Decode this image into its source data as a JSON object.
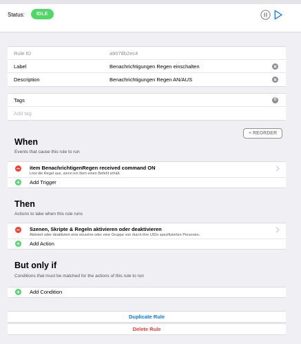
{
  "status": {
    "label": "Status:",
    "value": "IDLE",
    "color": "#4cd964"
  },
  "controls": {
    "pause_icon": "pause-circle-icon",
    "play_icon": "play-icon",
    "accent": "#007aff"
  },
  "fields": {
    "rule_id": {
      "label": "Rule ID",
      "value": "a9078b2ec4"
    },
    "label": {
      "label": "Label",
      "value": "Benachrichtigungen Regen einschalten"
    },
    "description": {
      "label": "Description",
      "value": "Benachrichtigungen Regen AN/AUS"
    }
  },
  "tags": {
    "label": "Tags",
    "count": "0",
    "placeholder": "Add tag"
  },
  "reorder_label": "≡ REORDER",
  "when": {
    "title": "When",
    "subtitle": "Events that cause this rule to run",
    "items": [
      {
        "title": "item BenachrichtigenRegen received command ON",
        "description": "Löst die Regel aus, wenn ein Item einen Befehl erhält."
      }
    ],
    "add_label": "Add Trigger"
  },
  "then": {
    "title": "Then",
    "subtitle": "Actions to take when this rule runs",
    "items": [
      {
        "title": "Szenen, Skripte & Regeln aktivieren oder deaktivieren",
        "description": "Aktiviert oder deaktiviert eine einzelne oder eine Gruppe von durch ihre UIDs spezifizierten Personen."
      }
    ],
    "add_label": "Add Action"
  },
  "only_if": {
    "title": "But only if",
    "subtitle": "Conditions that must be matched for the actions of this rule to run",
    "add_label": "Add Condition"
  },
  "buttons": {
    "duplicate": "Duplicate Rule",
    "delete": "Delete Rule"
  },
  "colors": {
    "remove": "#ff3b30",
    "add": "#4cd964",
    "delete": "#ff3b30",
    "link": "#007aff"
  }
}
